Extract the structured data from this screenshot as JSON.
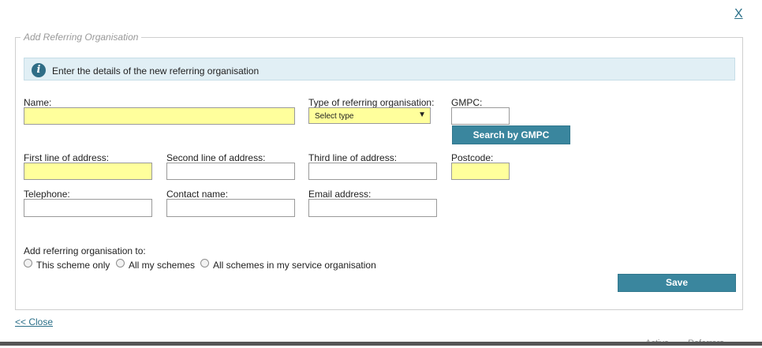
{
  "dialog": {
    "close_x": "X",
    "legend": "Add Referring Organisation",
    "info_text": "Enter the details of the new referring organisation",
    "close_link": "<< Close"
  },
  "form": {
    "name_label": "Name:",
    "type_label": "Type of referring organisation:",
    "type_selected": "Select type",
    "gmpc_label": "GMPC:",
    "search_gmpc_button": "Search by GMPC",
    "address1_label": "First line of address:",
    "address2_label": "Second line of address:",
    "address3_label": "Third line of address:",
    "postcode_label": "Postcode:",
    "telephone_label": "Telephone:",
    "contact_label": "Contact name:",
    "email_label": "Email address:",
    "name_value": "",
    "gmpc_value": "",
    "address1_value": "",
    "address2_value": "",
    "address3_value": "",
    "postcode_value": "",
    "telephone_value": "",
    "contact_value": "",
    "email_value": ""
  },
  "scope": {
    "label": "Add referring organisation to:",
    "options": [
      "This scheme only",
      "All my schemes",
      "All schemes in my service organisation"
    ]
  },
  "actions": {
    "save": "Save"
  },
  "background": {
    "peek_1": "Active",
    "peek_2": "Referrers"
  },
  "colors": {
    "accent": "#3a869e",
    "required_field": "#ffff9c",
    "info_bg": "#e1eff5"
  },
  "icons": {
    "info": "info-circle-icon",
    "dropdown": "triangle-down-icon"
  }
}
